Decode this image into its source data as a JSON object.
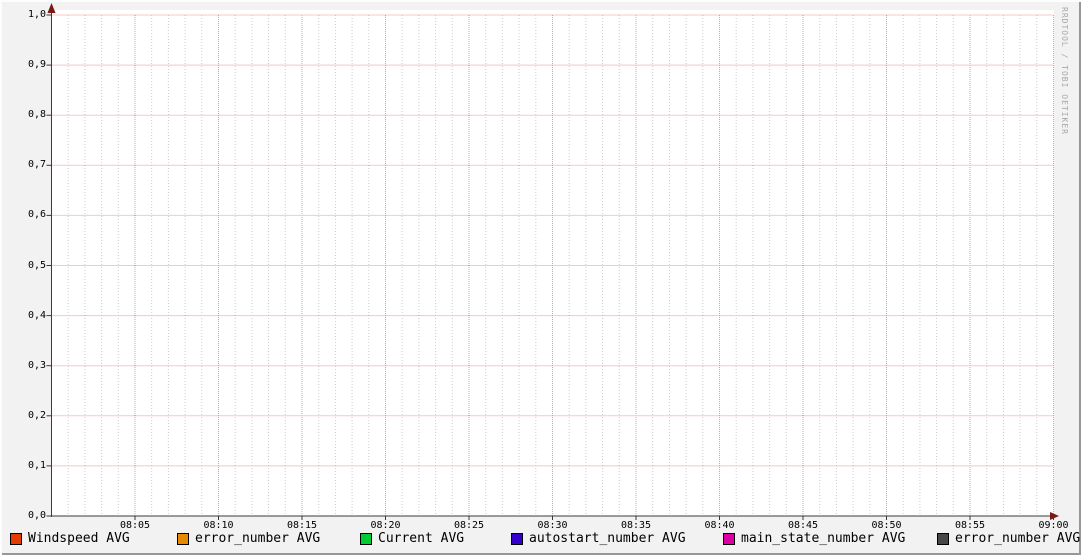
{
  "watermark": "RRDTOOL / TOBI OETIKER",
  "colors": {
    "background": "#F2F2F2",
    "canvas": "#FFFFFF",
    "major_grid": "#EC9393",
    "minor_grid": "#CCCCCC",
    "axis": "#3A3A3A",
    "arrow": "#7A1A14",
    "watermark_text": "#A8A8A8",
    "bevel_shadow": "#979797",
    "bevel_highlight": "#FDFDFD",
    "legend_text": "#000000"
  },
  "chart_data": {
    "type": "line",
    "title": "",
    "xlabel": "",
    "ylabel": "",
    "x_axis": {
      "range": [
        "08:00",
        "09:00"
      ],
      "tick_labels": [
        "08:05",
        "08:10",
        "08:15",
        "08:20",
        "08:25",
        "08:30",
        "08:35",
        "08:40",
        "08:45",
        "08:50",
        "08:55",
        "09:00"
      ],
      "major_grid_interval_minutes": 5,
      "minor_grid_interval_minutes": 1
    },
    "y_axis": {
      "min": 0.0,
      "max": 1.0,
      "tick_step": 0.1,
      "tick_labels": [
        "1,0",
        "0,9",
        "0,8",
        "0,7",
        "0,6",
        "0,5",
        "0,4",
        "0,3",
        "0,2",
        "0,1",
        "0,0"
      ]
    },
    "grid": true,
    "legend_position": "bottom",
    "series": [
      {
        "name": "Windspeed AVG",
        "color": "#E33B00",
        "values": []
      },
      {
        "name": "error_number AVG",
        "color": "#E78A00",
        "values": []
      },
      {
        "name": "Current AVG",
        "color": "#00CC33",
        "values": []
      },
      {
        "name": "autostart_number AVG",
        "color": "#3300CC",
        "values": []
      },
      {
        "name": "main_state_number AVG",
        "color": "#DD00A5",
        "values": []
      },
      {
        "name": "error_number AVG",
        "color": "#474747",
        "values": []
      }
    ]
  }
}
